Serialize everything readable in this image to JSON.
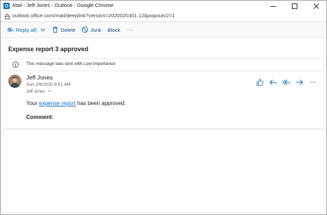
{
  "window": {
    "title": "Mail - Jeff Jones - Outlook - Google Chrome",
    "url": "outlook.office.com/mail/deeplink?version=2020020301.12&popoutv2=1"
  },
  "toolbar": {
    "reply_all": "Reply all",
    "delete": "Delete",
    "junk": "Junk",
    "block": "Block",
    "more": "···"
  },
  "message": {
    "subject": "Expense report 3 approved",
    "importance_notice": "This message was sent with Low importance",
    "sender": "Jeff Jones",
    "date": "Sun 2/9/2020 8:51 AM",
    "to": "Jeff Jones",
    "body_before": "Your ",
    "body_link": "expense report",
    "body_after": " has been approved.",
    "comment_label": "Comment:"
  },
  "colors": {
    "accent": "#0f6cbd",
    "panel": "#ffffff",
    "background": "#faf9f8"
  },
  "icons": {
    "reply_all": "reply-all-icon",
    "delete": "trash-icon",
    "junk": "block-circle-icon",
    "block": "none",
    "like": "thumbs-up-icon",
    "reply": "reply-icon",
    "reply_all_msg": "reply-all-icon",
    "forward": "forward-arrow-icon"
  }
}
